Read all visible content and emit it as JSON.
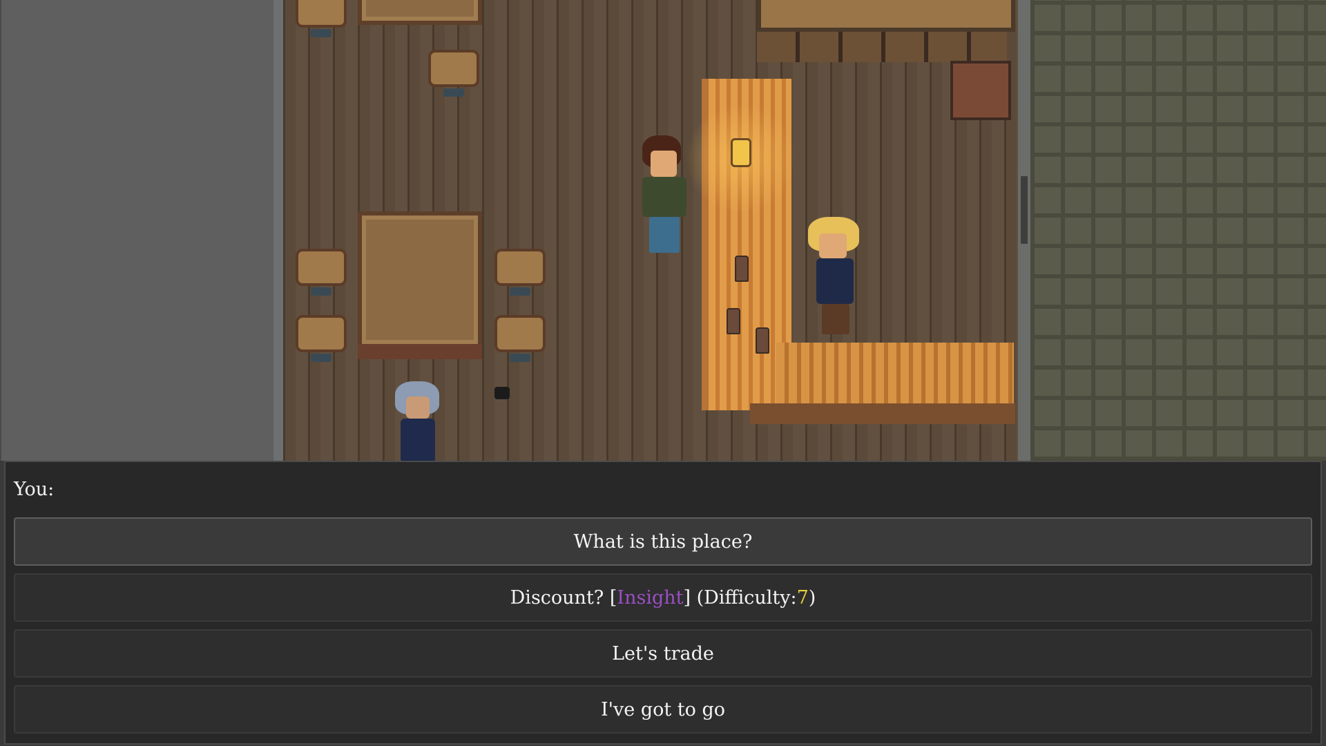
{
  "dialogue": {
    "speaker_label": "You:",
    "options": [
      {
        "label": "What is this place?",
        "selected": true
      },
      {
        "prefix": "Discount? [",
        "skill": "Insight",
        "middle": "] (Difficulty: ",
        "difficulty": "7",
        "suffix": ")"
      },
      {
        "label": "Let's trade"
      },
      {
        "label": "I've got to go"
      }
    ]
  },
  "colors": {
    "skill_text": "#9a4fc4",
    "difficulty_text": "#e5d23a",
    "panel_bg": "#282828"
  }
}
